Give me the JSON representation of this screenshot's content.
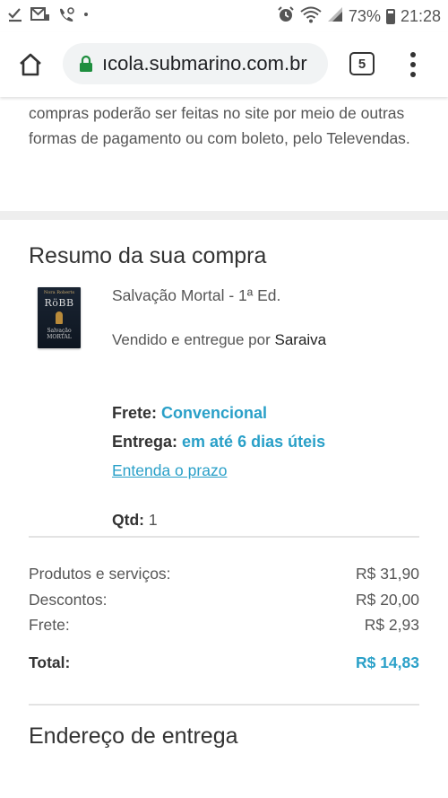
{
  "status_bar": {
    "left_icons": [
      "download-done-icon",
      "message-icon",
      "voicemail-icon",
      "dot-icon"
    ],
    "right_icons": [
      "alarm-icon",
      "wifi-icon",
      "signal-icon"
    ],
    "battery_percent": "73%",
    "time": "21:28"
  },
  "browser": {
    "url": "ıcola.submarino.com.br",
    "tab_count": "5"
  },
  "notice": {
    "text": "compras poderão ser feitas no site por meio de outras formas de pagamento ou com boleto, pelo Televendas."
  },
  "summary": {
    "title": "Resumo da sua compra",
    "book_cover": {
      "author": "Nora Roberts",
      "pen_name": "RöBB",
      "title": "Salvação MORTAL"
    },
    "product_name": "Salvação Mortal - 1ª Ed.",
    "seller_prefix": "Vendido e entregue por",
    "seller_name": "Saraiva",
    "frete_label": "Frete:",
    "frete_value": "Convencional",
    "entrega_label": "Entrega:",
    "entrega_value": "em até 6 dias úteis",
    "prazo_link": "Entenda o prazo",
    "qtd_label": "Qtd:",
    "qtd_value": "1"
  },
  "totals": {
    "rows": [
      {
        "label": "Produtos e serviços:",
        "value": "R$ 31,90"
      },
      {
        "label": "Descontos:",
        "value": "R$ 20,00"
      },
      {
        "label": "Frete:",
        "value": "R$ 2,93"
      }
    ],
    "total_label": "Total:",
    "total_value": "R$ 14,83"
  },
  "address": {
    "title": "Endereço de entrega"
  },
  "colors": {
    "accent": "#2aa0c8",
    "lock": "#1e8e3e"
  }
}
